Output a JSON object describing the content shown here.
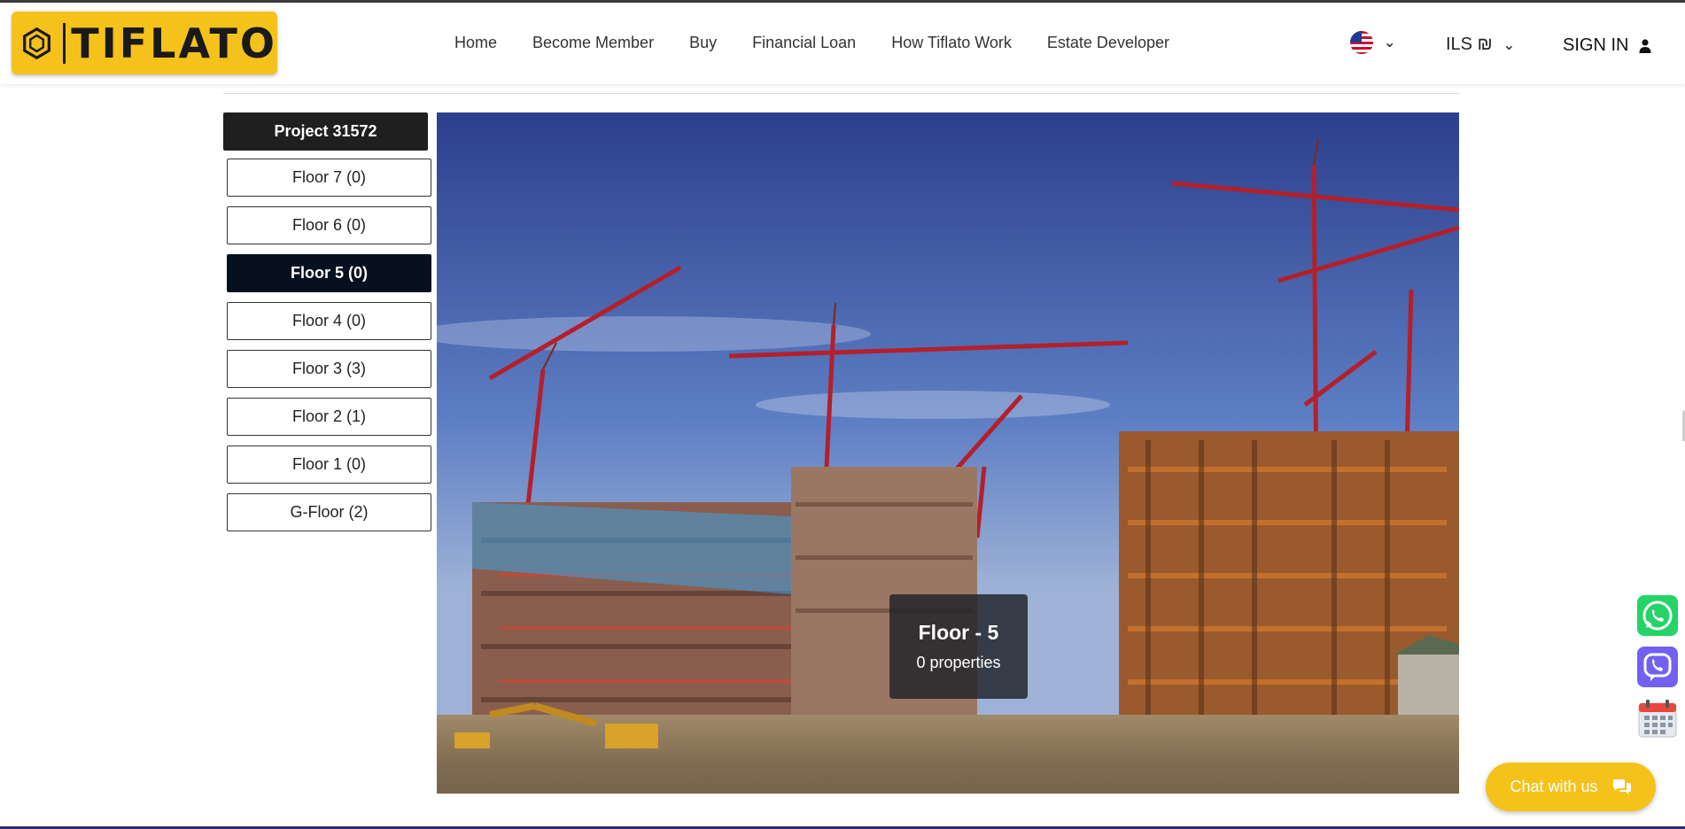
{
  "brand": {
    "name": "TIFLATO",
    "accent": "#f5c21b"
  },
  "nav": {
    "items": [
      {
        "label": "Home"
      },
      {
        "label": "Become Member"
      },
      {
        "label": "Buy"
      },
      {
        "label": "Financial Loan"
      },
      {
        "label": "How Tiflato Work"
      },
      {
        "label": "Estate Developer"
      }
    ]
  },
  "header": {
    "language_icon": "us-flag-icon",
    "currency": "ILS ₪",
    "signin": "SIGN IN"
  },
  "sidebar": {
    "project_title": "Project 31572",
    "floors": [
      {
        "label": "Floor 7 (0)",
        "active": false
      },
      {
        "label": "Floor 6 (0)",
        "active": false
      },
      {
        "label": "Floor 5 (0)",
        "active": true
      },
      {
        "label": "Floor 4 (0)",
        "active": false
      },
      {
        "label": "Floor 3 (3)",
        "active": false
      },
      {
        "label": "Floor 2 (1)",
        "active": false
      },
      {
        "label": "Floor 1 (0)",
        "active": false
      },
      {
        "label": "G-Floor (2)",
        "active": false
      }
    ]
  },
  "hero": {
    "tooltip_title": "Floor - 5",
    "tooltip_subtitle": "0 properties"
  },
  "floating": {
    "chat_label": "Chat with us",
    "icons": [
      "whatsapp-icon",
      "viber-icon",
      "calendar-icon"
    ]
  }
}
